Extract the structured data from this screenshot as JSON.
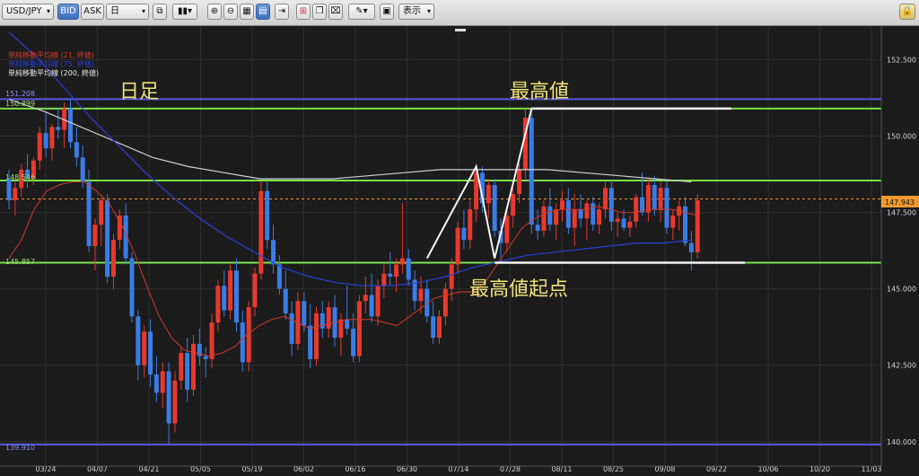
{
  "toolbar": {
    "symbol": "USD/JPY",
    "bid_label": "BID",
    "ask_label": "ASK",
    "timeframe": "日",
    "display_label": "表示"
  },
  "legend": [
    {
      "label": "単純移動平均線 (21, 終値)",
      "color": "#d23a2a"
    },
    {
      "label": "単純移動平均線 (75, 終値)",
      "color": "#2b3fd6"
    },
    {
      "label": "単純移動平均線 (200, 終値)",
      "color": "#e8e8e8"
    }
  ],
  "annotations": {
    "timeframe_label": "日足",
    "high_label": "最高値",
    "high_origin_label": "最高値起点"
  },
  "colors": {
    "background": "#1c1c1c",
    "up_candle": "#e8392f",
    "down_candle": "#3a7de6",
    "ma21": "#d23a2a",
    "ma75": "#2b3fd6",
    "ma200": "#cfcfcf",
    "green_line": "#7de04a",
    "blue_line": "#5a5ae0",
    "current_price": "#f29a2e"
  },
  "chart_data": {
    "type": "candlestick",
    "pair": "USD/JPY",
    "timeframe": "daily",
    "ylim": [
      139.2,
      153.6
    ],
    "y_ticks": [
      "152.500",
      "150.000",
      "147.500",
      "145.000",
      "142.500",
      "140.000"
    ],
    "x_ticks": [
      "03/24",
      "04/07",
      "04/21",
      "05/05",
      "05/19",
      "06/02",
      "06/16",
      "06/30",
      "07/14",
      "07/28",
      "08/11",
      "08/25",
      "09/08",
      "09/22",
      "10/06",
      "10/20",
      "11/03"
    ],
    "current_price": "147.943",
    "horizontal_lines": [
      {
        "label": "151.208",
        "value": 151.208,
        "color": "blue"
      },
      {
        "label": "150.899",
        "value": 150.899,
        "color": "green"
      },
      {
        "label": "148.546",
        "value": 148.546,
        "color": "green"
      },
      {
        "label": "145.857",
        "value": 145.857,
        "color": "green"
      },
      {
        "label": "139.910",
        "value": 139.91,
        "color": "blue"
      }
    ],
    "candles": [
      [
        148.6,
        148.9,
        147.6,
        147.9
      ],
      [
        147.9,
        148.5,
        147.4,
        148.3
      ],
      [
        148.3,
        149.1,
        148.0,
        148.9
      ],
      [
        148.9,
        149.4,
        148.3,
        148.6
      ],
      [
        148.6,
        149.3,
        148.4,
        149.2
      ],
      [
        149.2,
        150.3,
        148.9,
        150.1
      ],
      [
        150.1,
        150.8,
        149.3,
        149.6
      ],
      [
        149.6,
        150.4,
        149.2,
        150.3
      ],
      [
        150.3,
        150.9,
        149.9,
        150.2
      ],
      [
        150.2,
        151.1,
        149.6,
        150.9
      ],
      [
        150.9,
        151.2,
        149.6,
        149.8
      ],
      [
        149.8,
        150.3,
        149.0,
        149.3
      ],
      [
        149.3,
        149.7,
        148.3,
        148.5
      ],
      [
        148.5,
        148.9,
        146.2,
        146.4
      ],
      [
        146.4,
        147.3,
        145.6,
        147.1
      ],
      [
        147.1,
        148.0,
        146.4,
        147.9
      ],
      [
        147.9,
        148.1,
        145.2,
        145.4
      ],
      [
        145.4,
        146.8,
        145.0,
        146.6
      ],
      [
        146.6,
        147.6,
        146.3,
        147.4
      ],
      [
        147.4,
        147.8,
        145.8,
        146.0
      ],
      [
        146.0,
        146.2,
        143.9,
        144.1
      ],
      [
        144.1,
        144.3,
        142.0,
        142.5
      ],
      [
        142.5,
        143.8,
        142.1,
        143.6
      ],
      [
        143.6,
        144.0,
        141.8,
        142.2
      ],
      [
        142.2,
        142.8,
        141.3,
        141.6
      ],
      [
        141.6,
        142.6,
        141.1,
        142.3
      ],
      [
        142.3,
        142.6,
        139.9,
        140.6
      ],
      [
        140.6,
        142.3,
        140.3,
        142.0
      ],
      [
        142.0,
        143.1,
        141.7,
        142.9
      ],
      [
        142.9,
        143.4,
        141.3,
        141.7
      ],
      [
        141.7,
        143.5,
        141.5,
        143.2
      ],
      [
        143.2,
        143.7,
        142.5,
        142.8
      ],
      [
        142.8,
        143.1,
        142.1,
        142.7
      ],
      [
        142.7,
        144.2,
        142.4,
        143.9
      ],
      [
        143.9,
        145.3,
        143.6,
        145.1
      ],
      [
        145.1,
        145.6,
        144.1,
        144.3
      ],
      [
        144.3,
        145.8,
        144.0,
        145.6
      ],
      [
        145.6,
        146.0,
        143.6,
        143.9
      ],
      [
        143.9,
        144.3,
        142.3,
        142.6
      ],
      [
        142.6,
        144.6,
        142.3,
        144.4
      ],
      [
        144.4,
        145.7,
        144.1,
        145.5
      ],
      [
        145.5,
        148.5,
        145.3,
        148.2
      ],
      [
        148.2,
        148.5,
        146.3,
        146.6
      ],
      [
        146.6,
        147.1,
        145.5,
        145.8
      ],
      [
        145.8,
        146.1,
        144.8,
        145.0
      ],
      [
        145.0,
        145.6,
        144.0,
        144.2
      ],
      [
        144.2,
        144.6,
        142.8,
        143.2
      ],
      [
        143.2,
        144.9,
        143.0,
        144.6
      ],
      [
        144.6,
        144.9,
        143.6,
        143.8
      ],
      [
        143.8,
        144.5,
        142.4,
        142.7
      ],
      [
        142.7,
        144.4,
        142.5,
        144.2
      ],
      [
        144.2,
        144.6,
        143.4,
        143.7
      ],
      [
        143.7,
        144.6,
        143.4,
        144.4
      ],
      [
        144.4,
        144.8,
        143.1,
        143.4
      ],
      [
        143.4,
        144.2,
        142.8,
        144.0
      ],
      [
        144.0,
        145.1,
        143.5,
        143.7
      ],
      [
        143.7,
        144.2,
        142.6,
        142.8
      ],
      [
        142.8,
        144.8,
        142.6,
        144.6
      ],
      [
        144.6,
        145.4,
        144.2,
        144.8
      ],
      [
        144.8,
        145.5,
        143.9,
        144.1
      ],
      [
        144.1,
        145.3,
        143.8,
        145.1
      ],
      [
        145.1,
        145.8,
        144.7,
        145.5
      ],
      [
        145.5,
        146.2,
        145.1,
        145.4
      ],
      [
        145.4,
        146.0,
        144.9,
        145.8
      ],
      [
        145.8,
        147.8,
        145.5,
        146.0
      ],
      [
        146.0,
        146.3,
        145.1,
        145.3
      ],
      [
        145.3,
        145.6,
        144.3,
        144.6
      ],
      [
        144.6,
        145.4,
        144.2,
        145.0
      ],
      [
        145.0,
        145.3,
        143.9,
        144.1
      ],
      [
        144.1,
        144.6,
        143.2,
        143.4
      ],
      [
        143.4,
        144.3,
        143.2,
        144.1
      ],
      [
        144.1,
        145.2,
        143.8,
        145.0
      ],
      [
        145.0,
        146.0,
        144.6,
        145.8
      ],
      [
        145.8,
        147.2,
        145.5,
        147.0
      ],
      [
        147.0,
        147.6,
        146.3,
        146.6
      ],
      [
        146.6,
        147.9,
        146.3,
        147.6
      ],
      [
        147.6,
        149.1,
        147.2,
        148.8
      ],
      [
        148.8,
        149.0,
        147.5,
        147.8
      ],
      [
        147.8,
        148.6,
        147.3,
        148.4
      ],
      [
        148.4,
        148.6,
        146.7,
        146.9
      ],
      [
        146.9,
        147.3,
        145.9,
        146.5
      ],
      [
        146.5,
        147.6,
        146.2,
        147.4
      ],
      [
        147.4,
        148.3,
        147.0,
        148.1
      ],
      [
        148.1,
        149.1,
        147.8,
        148.9
      ],
      [
        148.9,
        150.9,
        148.6,
        150.6
      ],
      [
        150.6,
        150.9,
        146.8,
        147.1
      ],
      [
        147.1,
        147.6,
        146.6,
        146.9
      ],
      [
        146.9,
        147.9,
        146.7,
        147.7
      ],
      [
        147.7,
        148.3,
        146.9,
        147.1
      ],
      [
        147.1,
        147.8,
        146.6,
        147.6
      ],
      [
        147.6,
        148.2,
        147.2,
        147.9
      ],
      [
        147.9,
        148.3,
        146.8,
        147.0
      ],
      [
        147.0,
        148.1,
        146.4,
        147.6
      ],
      [
        147.6,
        148.1,
        147.0,
        147.3
      ],
      [
        147.3,
        147.9,
        146.6,
        147.8
      ],
      [
        147.8,
        148.0,
        146.9,
        147.1
      ],
      [
        147.1,
        147.8,
        146.8,
        147.6
      ],
      [
        147.6,
        148.5,
        147.3,
        148.3
      ],
      [
        148.3,
        148.6,
        146.9,
        147.2
      ],
      [
        147.2,
        147.5,
        146.7,
        147.3
      ],
      [
        147.3,
        147.6,
        146.9,
        147.0
      ],
      [
        147.0,
        147.4,
        146.7,
        147.2
      ],
      [
        147.2,
        148.1,
        147.0,
        148.0
      ],
      [
        148.0,
        148.8,
        147.4,
        147.5
      ],
      [
        147.5,
        148.6,
        147.2,
        148.4
      ],
      [
        148.4,
        148.7,
        147.4,
        147.6
      ],
      [
        147.6,
        148.5,
        147.2,
        148.3
      ],
      [
        148.3,
        148.5,
        146.8,
        147.0
      ],
      [
        147.0,
        147.6,
        146.6,
        147.4
      ],
      [
        147.4,
        147.9,
        146.9,
        147.7
      ],
      [
        147.7,
        148.0,
        146.4,
        146.5
      ],
      [
        146.5,
        146.9,
        145.6,
        146.2
      ],
      [
        146.2,
        148.1,
        146.0,
        147.9
      ]
    ],
    "ma21": [
      146.0,
      146.6,
      147.6,
      148.2,
      148.4,
      148.5,
      148.5,
      148.2,
      147.8,
      147.1,
      146.2,
      145.1,
      144.1,
      143.4,
      143.0,
      142.9,
      142.8,
      142.9,
      143.1,
      143.5,
      143.8,
      144.0,
      144.1,
      143.9,
      143.7,
      143.8,
      143.9,
      144.0,
      144.0,
      144.0,
      143.9,
      143.8,
      144.1,
      144.4,
      144.7,
      144.8,
      144.9,
      144.9,
      145.2,
      145.8,
      146.4,
      147.0,
      147.3,
      147.5,
      147.6,
      147.6,
      147.6,
      147.7,
      147.6,
      147.5,
      147.5,
      147.6,
      147.6,
      147.6,
      147.5,
      147.4
    ],
    "ma75": [
      153.4,
      152.6,
      151.6,
      150.6,
      149.7,
      148.8,
      148.0,
      147.3,
      146.7,
      146.2,
      145.7,
      145.4,
      145.2,
      145.1,
      145.1,
      145.2,
      145.4,
      145.7,
      145.9,
      146.1,
      146.2,
      146.3,
      146.4,
      146.5,
      146.5,
      146.6
    ],
    "ma200": [
      151.2,
      150.8,
      150.3,
      149.8,
      149.3,
      149.0,
      148.8,
      148.6,
      148.6,
      148.6,
      148.7,
      148.8,
      148.9,
      148.9,
      148.9,
      148.9,
      148.8,
      148.7,
      148.6,
      148.5
    ]
  }
}
